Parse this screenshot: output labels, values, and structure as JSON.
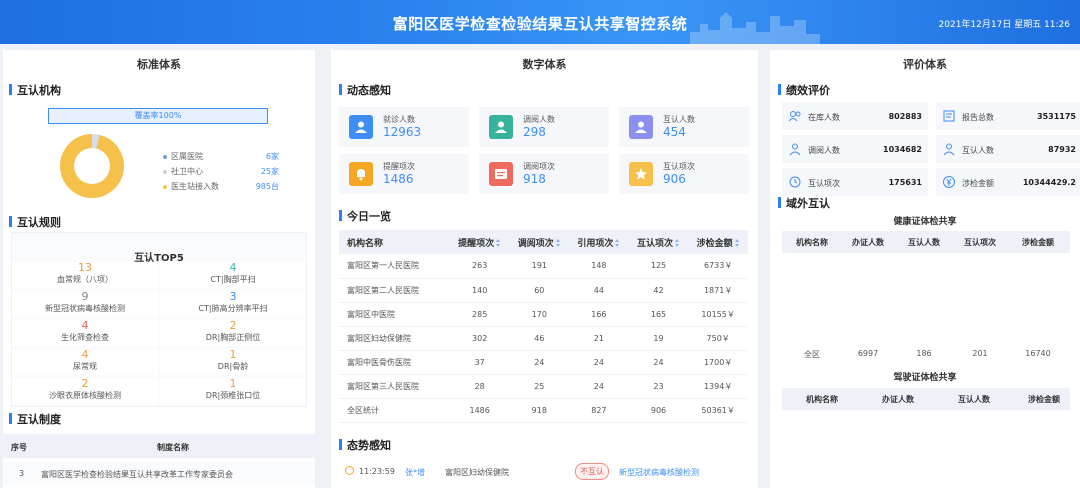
{
  "header": {
    "title": "富阳区医学检查检验结果互认共享智控系统",
    "datetime": "2021年12月17日 星期五 11:26"
  },
  "left": {
    "panel_title": "标准体系",
    "institutions": {
      "section": "互认机构",
      "coverage": "覆盖率100%",
      "legend": [
        {
          "label": "区属医院",
          "value": "6家",
          "color": "#6f9bd9"
        },
        {
          "label": "社卫中心",
          "value": "25家",
          "color": "#c9d1dc"
        },
        {
          "label": "医生站接入数",
          "value": "985台",
          "color": "#f6c14a"
        }
      ]
    },
    "rules": {
      "section": "互认规则",
      "top5_title": "互认TOP5",
      "items": [
        {
          "num": "13",
          "label": "血常规（八项）",
          "color": "#e6a23c"
        },
        {
          "num": "4",
          "label": "CT|胸部平扫",
          "color": "#3cb9b0"
        },
        {
          "num": "9",
          "label": "新型冠状病毒核酸检测",
          "color": "#888888"
        },
        {
          "num": "3",
          "label": "CT|肺高分辨率平扫",
          "color": "#3f8ef5"
        },
        {
          "num": "4",
          "label": "生化筛查检查",
          "color": "#e8615a"
        },
        {
          "num": "2",
          "label": "DR|胸部正侧位",
          "color": "#e6a23c"
        },
        {
          "num": "4",
          "label": "尿常规",
          "color": "#e6a23c"
        },
        {
          "num": "1",
          "label": "DR|骨龄",
          "color": "#e6a23c"
        },
        {
          "num": "2",
          "label": "沙眼衣原体核酸检测",
          "color": "#e6a23c"
        },
        {
          "num": "1",
          "label": "DR|颈椎张口位",
          "color": "#e6a23c"
        }
      ]
    },
    "system": {
      "section": "互认制度",
      "col_no": "序号",
      "col_name": "制度名称",
      "rows": [
        {
          "no": "3",
          "name": "富阳区医学检查检验结果互认共享改革工作专家委员会"
        }
      ]
    }
  },
  "mid": {
    "panel_title": "数字体系",
    "dynamic": {
      "section": "动态感知",
      "cards": [
        {
          "label": "就诊人数",
          "value": "12963",
          "color": "#3f8ef5",
          "icon": "person-icon"
        },
        {
          "label": "调阅人数",
          "value": "298",
          "color": "#36b39a",
          "icon": "person-icon"
        },
        {
          "label": "互认人数",
          "value": "454",
          "color": "#8a8ff0",
          "icon": "person-icon"
        },
        {
          "label": "提醒项次",
          "value": "1486",
          "color": "#f5a623",
          "icon": "bell-icon"
        },
        {
          "label": "调阅项次",
          "value": "918",
          "color": "#ee6a5e",
          "icon": "list-icon"
        },
        {
          "label": "互认项次",
          "value": "906",
          "color": "#f6c14a",
          "icon": "star-icon"
        }
      ]
    },
    "today": {
      "section": "今日一览",
      "columns": [
        "机构名称",
        "提醒项次",
        "调阅项次",
        "引用项次",
        "互认项次",
        "涉检金额"
      ],
      "rows": [
        [
          "富阳区第一人民医院",
          "263",
          "191",
          "148",
          "125",
          "6733￥"
        ],
        [
          "富阳区第二人民医院",
          "140",
          "60",
          "44",
          "42",
          "1871￥"
        ],
        [
          "富阳区中医院",
          "285",
          "170",
          "166",
          "165",
          "10155￥"
        ],
        [
          "富阳区妇幼保健院",
          "302",
          "46",
          "21",
          "19",
          "750￥"
        ],
        [
          "富阳中医骨伤医院",
          "37",
          "24",
          "24",
          "24",
          "1700￥"
        ],
        [
          "富阳区第三人民医院",
          "28",
          "25",
          "24",
          "23",
          "1394￥"
        ],
        [
          "全区统计",
          "1486",
          "918",
          "827",
          "906",
          "50361￥"
        ]
      ]
    },
    "situation": {
      "section": "态势感知",
      "entry": {
        "time": "11:23:59",
        "name": "张*增",
        "hospital": "富阳区妇幼保健院",
        "tag": "不互认",
        "item": "新型冠状病毒核酸检测"
      }
    }
  },
  "right": {
    "panel_title": "评价体系",
    "perf": {
      "section": "绩效评价",
      "stats": [
        {
          "label": "在库人数",
          "value": "802883",
          "icon": "people-icon"
        },
        {
          "label": "报告总数",
          "value": "3531175",
          "icon": "report-icon"
        },
        {
          "label": "调阅人数",
          "value": "1034682",
          "icon": "user-icon"
        },
        {
          "label": "互认人数",
          "value": "87932",
          "icon": "user-icon"
        },
        {
          "label": "互认项次",
          "value": "175631",
          "icon": "refresh-icon"
        },
        {
          "label": "涉检金额",
          "value": "10344429.2",
          "icon": "yen-icon"
        }
      ]
    },
    "external": {
      "section": "域外互认",
      "health_title": "健康证体检共享",
      "health_columns": [
        "机构名称",
        "办证人数",
        "互认人数",
        "互认项次",
        "涉检金额"
      ],
      "health_row": [
        "全区",
        "6997",
        "186",
        "201",
        "16740"
      ],
      "driver_title": "驾驶证体检共享",
      "driver_columns": [
        "机构名称",
        "办证人数",
        "互认人数",
        "涉检金额"
      ]
    }
  }
}
